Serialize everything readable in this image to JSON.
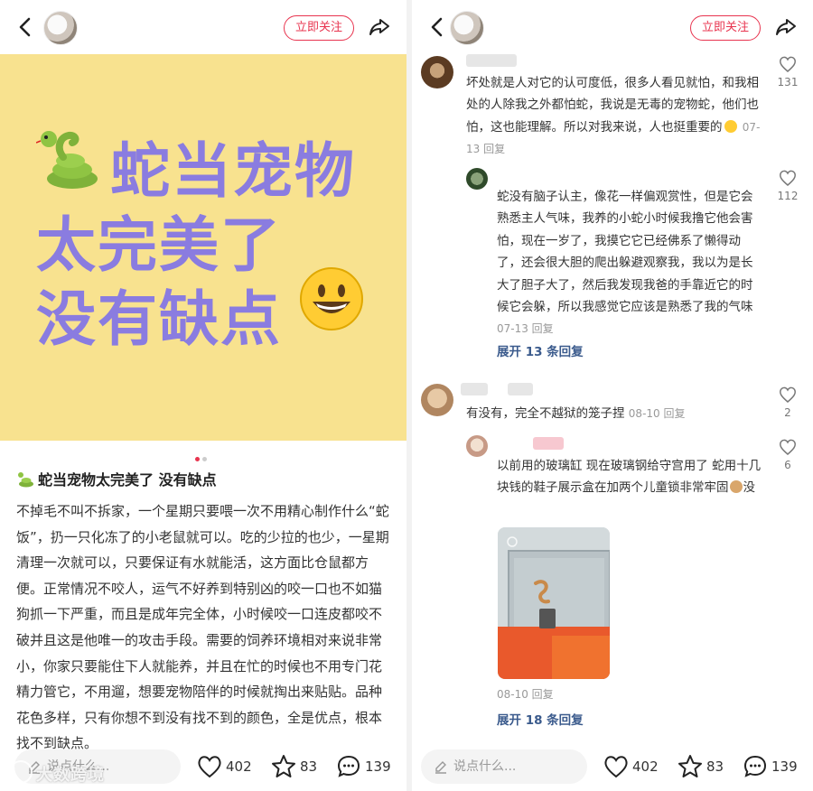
{
  "left": {
    "follow_label": "立即关注",
    "cover": {
      "line1": "蛇当宠物",
      "line2": "太完美了",
      "line3": "没有缺点"
    },
    "post_title": "蛇当宠物太完美了 没有缺点",
    "post_body": "不掉毛不叫不拆家，一个星期只要喂一次不用精心制作什么“蛇饭”，扔一只化冻了的小老鼠就可以。吃的少拉的也少，一星期清理一次就可以，只要保证有水就能活，这方面比仓鼠都方便。正常情况不咬人，运气不好养到特别凶的咬一口也不如猫狗抓一下严重，而且是成年完全体，小时候咬一口连皮都咬不破并且这是他唯一的攻击手段。需要的饲养环境相对来说非常小，你家只要能住下人就能养，并且在忙的时候也不用专门花精力管它，不用遛，想要宠物陪伴的时候就掏出来贴贴。品种花色多样，只有你想不到没有找不到的颜色，全是优点，根本找不到缺点。",
    "comment_placeholder": "说点什么...",
    "likes": "402",
    "stars": "83",
    "comments": "139",
    "watermark": "大数跨境"
  },
  "right": {
    "follow_label": "立即关注",
    "comment_placeholder": "说点什么...",
    "likes": "402",
    "stars": "83",
    "comments": "139",
    "comments_list": [
      {
        "text": "坏处就是人对它的认可度低，很多人看见就怕，和我相处的人除我之外都怕蛇，我说是无毒的宠物蛇，他们也怕，这也能理解。所以对我来说，人也挺重要的",
        "meta": "07-13 回复",
        "likes": "131"
      },
      {
        "text": "蛇没有脑子认主，像花一样偏观赏性，但是它会熟悉主人气味，我养的小蛇小时候我撸它他会害怕，现在一岁了，我摸它它已经佛系了懒得动了，还会很大胆的爬出躲避观察我，我以为是长大了胆子大了，然后我发现我爸的手靠近它的时候它会躲，所以我感觉它应该是熟悉了我的气味",
        "meta": "07-13 回复",
        "likes": "112"
      },
      {
        "text": "有没有，完全不越狱的笼子捏",
        "meta": "08-10 回复",
        "likes": "2"
      },
      {
        "text": "以前用的玻璃缸 现在玻璃钢给守宫用了 蛇用十几块钱的鞋子展示盒在加两个儿童锁非常牢固",
        "text_tail": "没",
        "meta": "08-10 回复",
        "likes": "6"
      }
    ],
    "expand_1": "展开 13 条回复",
    "expand_2": "展开 18 条回复"
  }
}
